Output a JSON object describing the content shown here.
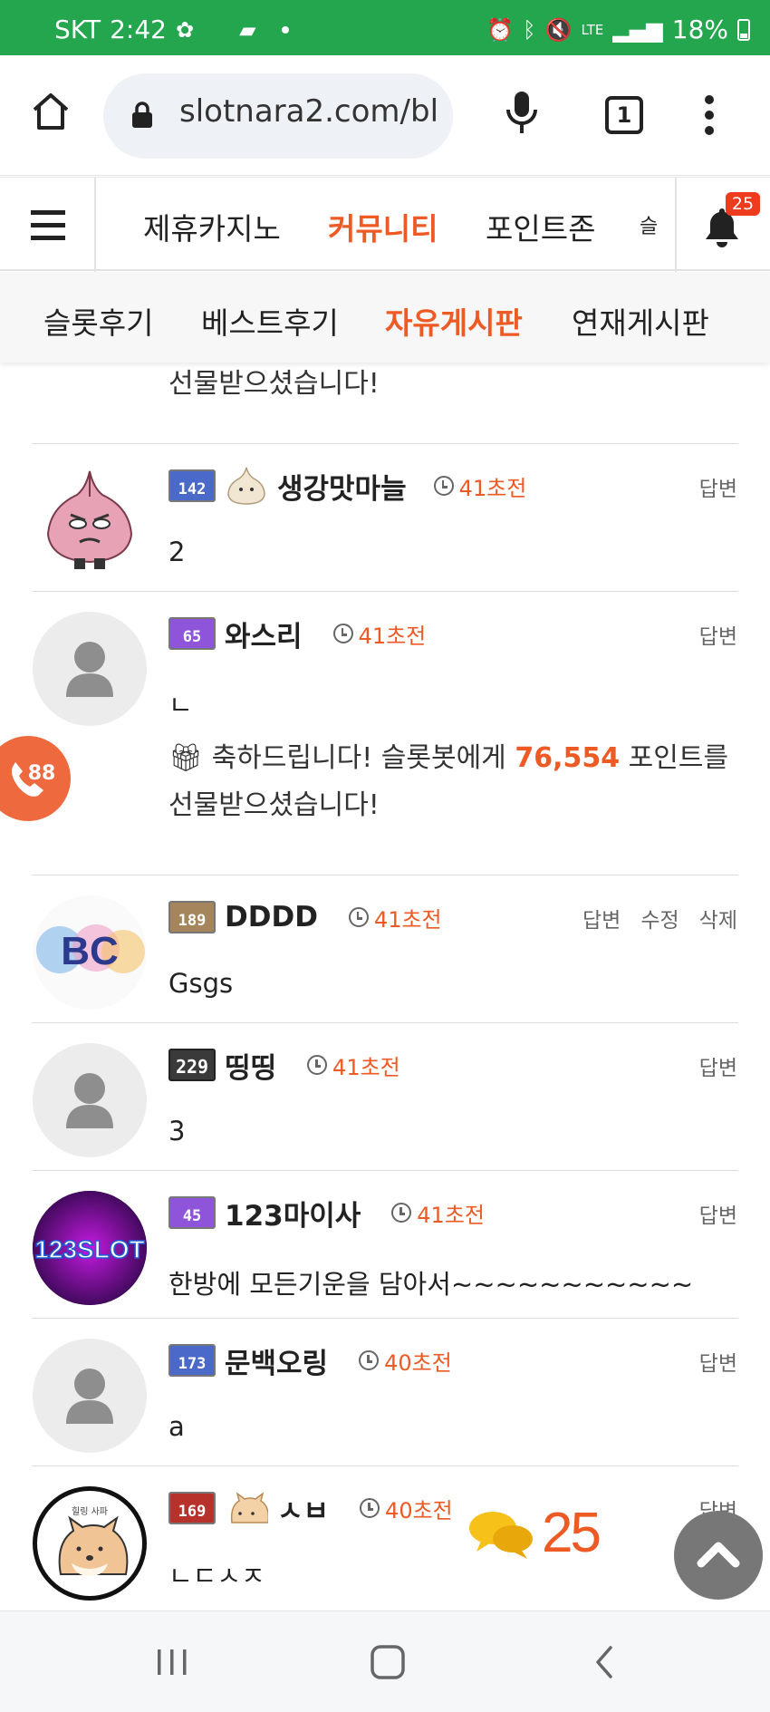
{
  "status_bar": {
    "carrier": "SKT",
    "time": "2:42",
    "network": "LTE",
    "battery": "18%"
  },
  "browser": {
    "url": "slotnara2.com/bl",
    "tab_count": "1"
  },
  "site_nav": {
    "items": [
      {
        "label": "제휴카지노",
        "active": false
      },
      {
        "label": "커뮤니티",
        "active": true
      },
      {
        "label": "포인트존",
        "active": false
      },
      {
        "label": "슬",
        "active": false
      }
    ],
    "notification_count": "25"
  },
  "sub_nav": {
    "items": [
      {
        "label": "슬롯후기",
        "active": false
      },
      {
        "label": "베스트후기",
        "active": false
      },
      {
        "label": "자유게시판",
        "active": true
      },
      {
        "label": "연재게시판",
        "active": false
      }
    ]
  },
  "top_gift_partial": "선물받으셨습니다!",
  "comments": [
    {
      "level": "142",
      "nickname": "생강맛마늘",
      "time": "41초전",
      "actions": [
        "답변"
      ],
      "body": "2"
    },
    {
      "level": "65",
      "nickname": "와스리",
      "time": "41초전",
      "actions": [
        "답변"
      ],
      "body": "ㄴ",
      "gift": {
        "prefix": "축하드립니다! 슬롯봇에게 ",
        "points": "76,554",
        "suffix": " 포인트를",
        "line2": "선물받으셨습니다!"
      }
    },
    {
      "level": "189",
      "nickname": "DDDD",
      "time": "41초전",
      "actions": [
        "답변",
        "수정",
        "삭제"
      ],
      "body": "Gsgs"
    },
    {
      "level": "229",
      "nickname": "띵띵",
      "time": "41초전",
      "actions": [
        "답변"
      ],
      "body": "3"
    },
    {
      "level": "45",
      "nickname": "123마이사",
      "time": "41초전",
      "actions": [
        "답변"
      ],
      "body": "한방에 모든기운을 담아서~~~~~~~~~~~"
    },
    {
      "level": "173",
      "nickname": "문백오링",
      "time": "40초전",
      "actions": [
        "답변"
      ],
      "body": "a"
    },
    {
      "level": "169",
      "nickname": "ㅅㅂ",
      "time": "40초전",
      "actions": [
        "답변"
      ],
      "body": "ㄴㄷㅅㅈ"
    }
  ],
  "avatars": {
    "slot123_text": "123SLOT",
    "abc_text": "BC",
    "cat_caption": "힐링 사파"
  },
  "floating": {
    "comment_count": "25"
  },
  "colors": {
    "accent": "#ee5a24",
    "status_bar": "#24a64e"
  }
}
